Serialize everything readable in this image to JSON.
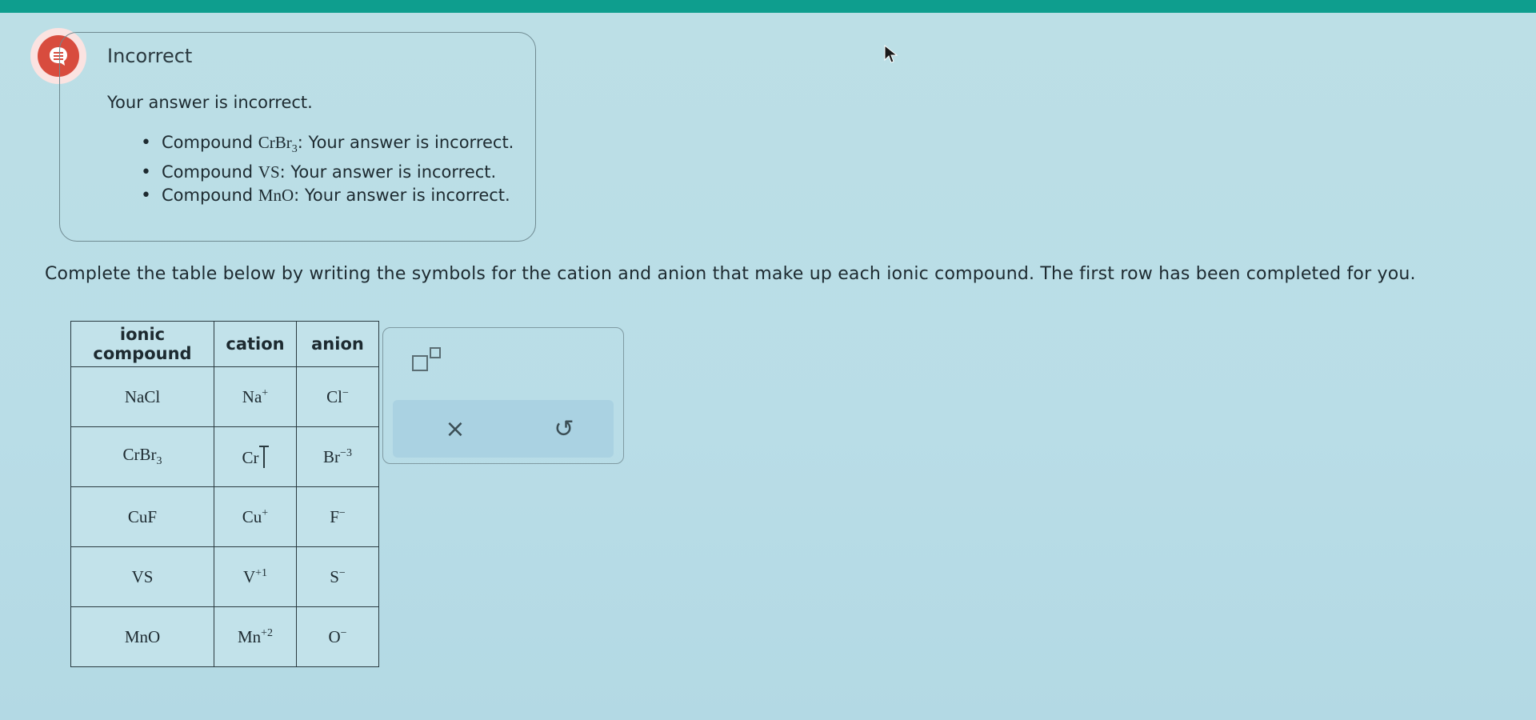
{
  "feedback": {
    "status": "Incorrect",
    "message": "Your answer is incorrect.",
    "items": [
      {
        "compound_label": "Compound ",
        "formula": "CrBr",
        "subscript": "3",
        "suffix": ": Your answer is incorrect."
      },
      {
        "compound_label": "Compound ",
        "formula": "VS",
        "subscript": "",
        "suffix": ": Your answer is incorrect."
      },
      {
        "compound_label": "Compound ",
        "formula": "MnO",
        "subscript": "",
        "suffix": ": Your answer is incorrect."
      }
    ]
  },
  "instruction": "Complete the table below by writing the symbols for the cation and anion that make up each ionic compound. The first row has been completed for you.",
  "table": {
    "headers": {
      "compound_line1": "ionic",
      "compound_line2": "compound",
      "cation": "cation",
      "anion": "anion"
    },
    "rows": [
      {
        "compound": "NaCl",
        "compound_sub": "",
        "cation": "Na",
        "cation_charge": "+",
        "anion": "Cl",
        "anion_charge": "−"
      },
      {
        "compound": "CrBr",
        "compound_sub": "3",
        "cation": "Cr",
        "cation_charge": "",
        "anion": "Br",
        "anion_charge": "−3"
      },
      {
        "compound": "CuF",
        "compound_sub": "",
        "cation": "Cu",
        "cation_charge": "+",
        "anion": "F",
        "anion_charge": "−"
      },
      {
        "compound": "VS",
        "compound_sub": "",
        "cation": "V",
        "cation_charge": "+1",
        "anion": "S",
        "anion_charge": "−"
      },
      {
        "compound": "MnO",
        "compound_sub": "",
        "cation": "Mn",
        "cation_charge": "+2",
        "anion": "O",
        "anion_charge": "−"
      }
    ]
  },
  "toolbox": {
    "superscript_tool_icon": "superscript-box-icon",
    "clear_symbol": "×",
    "undo_symbol": "↺"
  },
  "colors": {
    "topbar": "#0e9e8e",
    "error_icon": "#d84c3e",
    "background": "#bcdfe6"
  }
}
